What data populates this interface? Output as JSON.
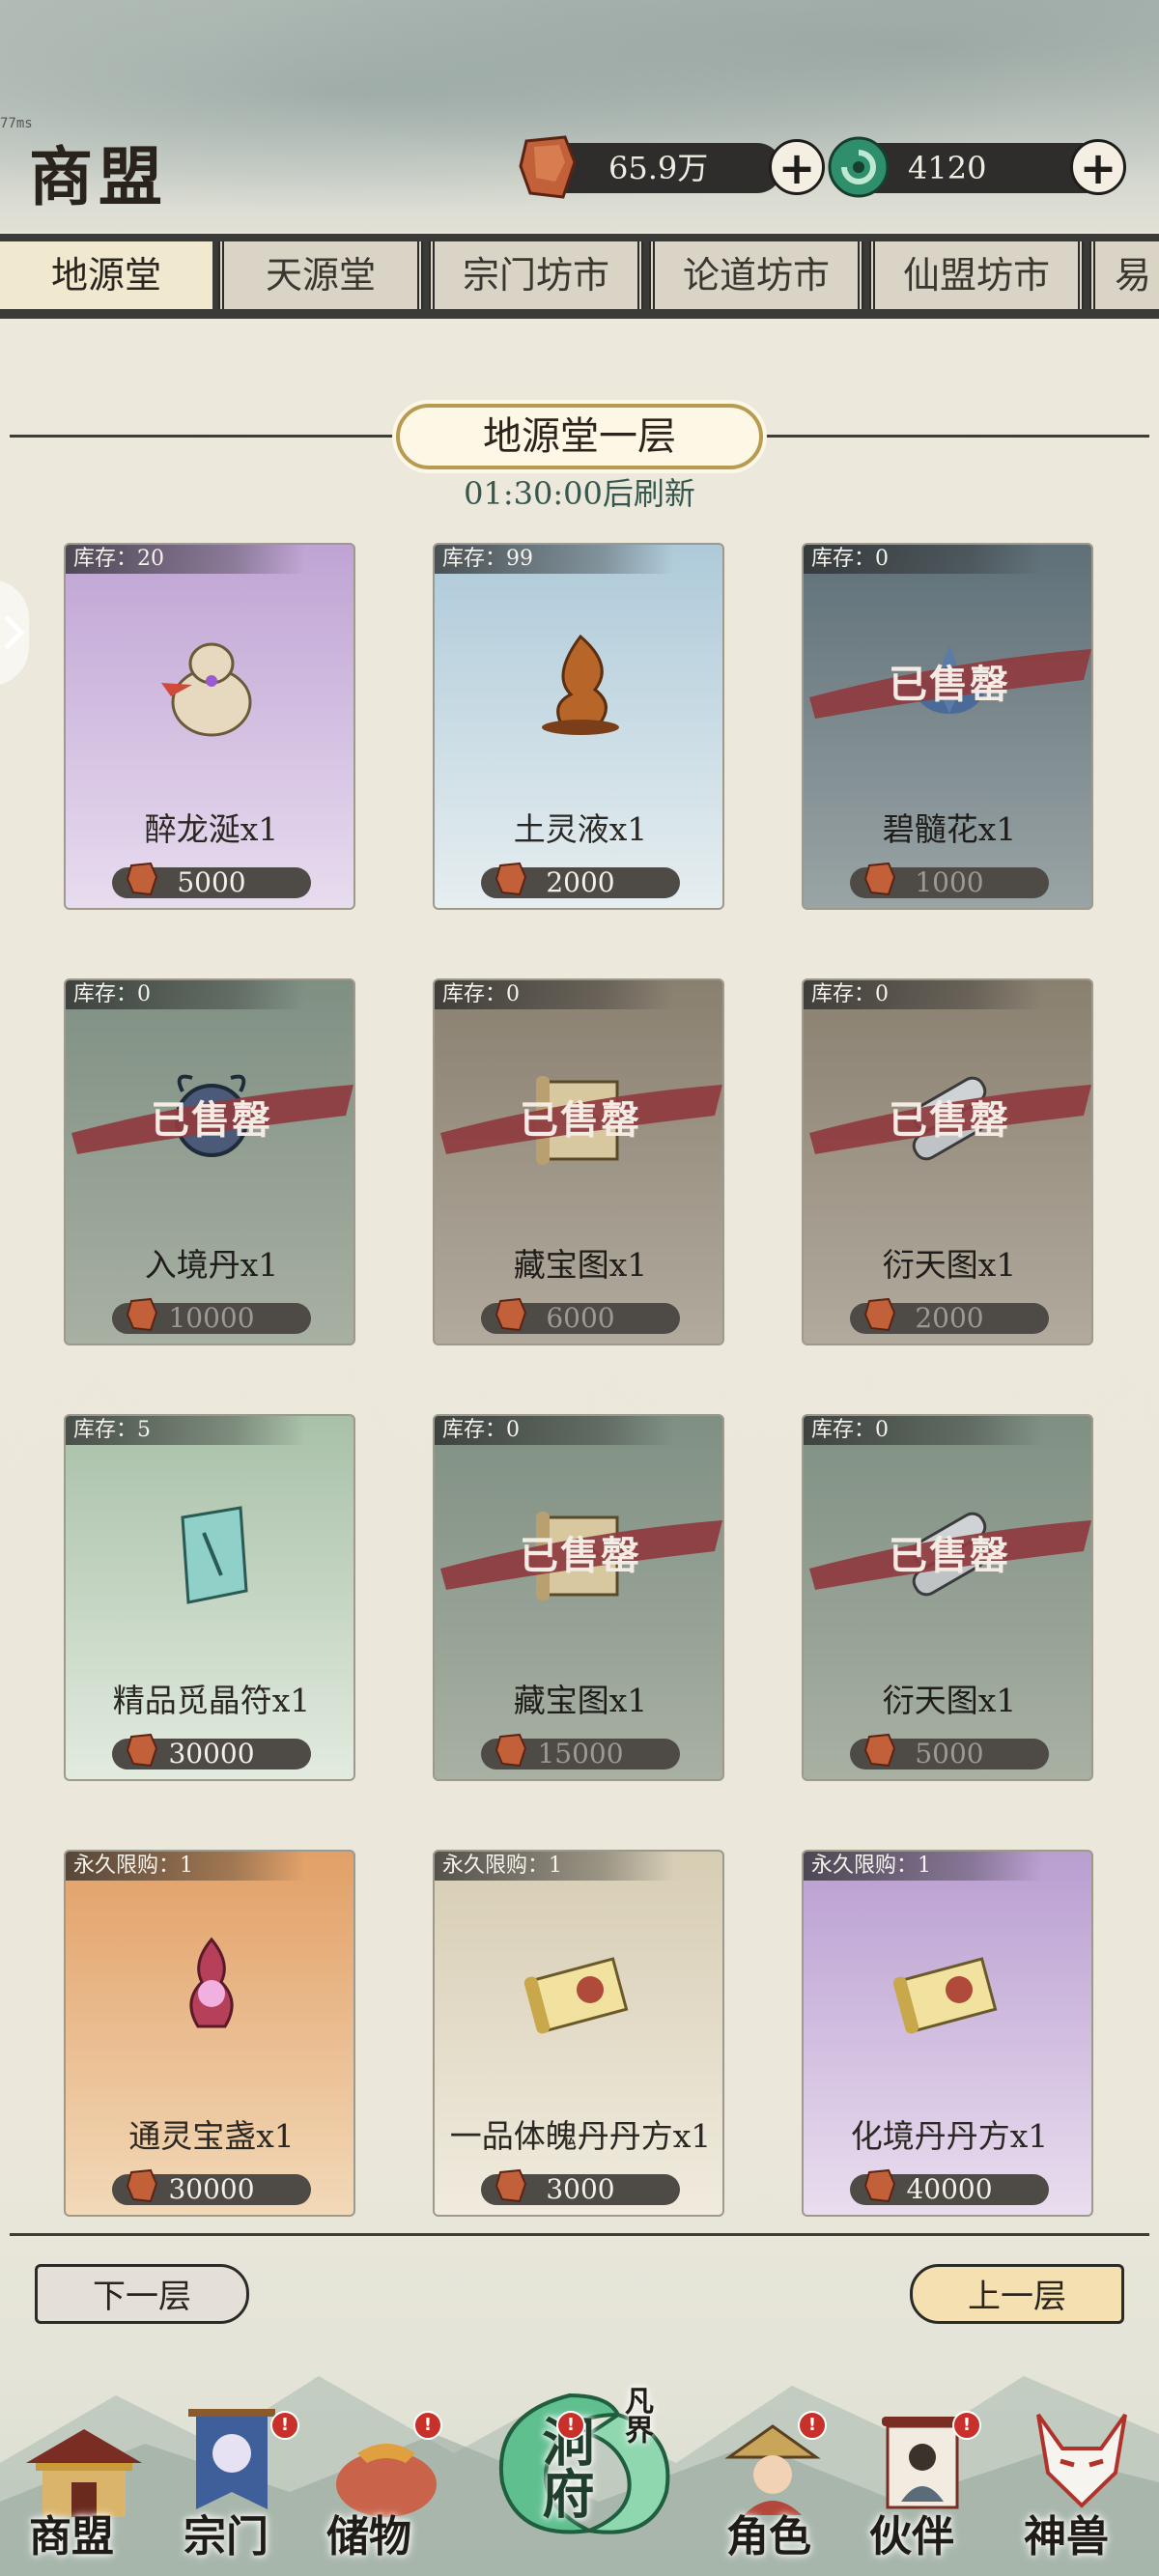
{
  "status": {
    "latency": "77ms"
  },
  "header": {
    "title": "商盟",
    "currency_spirit_stone": "65.9万",
    "currency_jade": "4120",
    "add_label": "+"
  },
  "tabs": [
    {
      "label": "地源堂",
      "active": true
    },
    {
      "label": "天源堂",
      "active": false
    },
    {
      "label": "宗门坊市",
      "active": false
    },
    {
      "label": "论道坊市",
      "active": false
    },
    {
      "label": "仙盟坊市",
      "active": false
    },
    {
      "label": "易",
      "active": false
    }
  ],
  "floor": {
    "title": "地源堂一层",
    "refresh": "01:30:00后刷新"
  },
  "sold_label": "已售罄",
  "items": [
    {
      "stock": "库存：20",
      "name": "醉龙涎x1",
      "price": "5000",
      "sold_out": false,
      "icon": "gourd-icon",
      "theme": "purple"
    },
    {
      "stock": "库存：99",
      "name": "土灵液x1",
      "price": "2000",
      "sold_out": false,
      "icon": "flame-icon",
      "theme": "blue"
    },
    {
      "stock": "库存：0",
      "name": "碧髓花x1",
      "price": "1000",
      "sold_out": true,
      "icon": "lotus-icon",
      "theme": "soldblue"
    },
    {
      "stock": "库存：0",
      "name": "入境丹x1",
      "price": "10000",
      "sold_out": true,
      "icon": "pill-icon",
      "theme": "green"
    },
    {
      "stock": "库存：0",
      "name": "藏宝图x1",
      "price": "6000",
      "sold_out": true,
      "icon": "map-scroll-icon",
      "theme": "brown"
    },
    {
      "stock": "库存：0",
      "name": "衍天图x1",
      "price": "2000",
      "sold_out": true,
      "icon": "rolled-scroll-icon",
      "theme": "brown"
    },
    {
      "stock": "库存：5",
      "name": "精品觅晶符x1",
      "price": "30000",
      "sold_out": false,
      "icon": "talisman-icon",
      "theme": "jade"
    },
    {
      "stock": "库存：0",
      "name": "藏宝图x1",
      "price": "15000",
      "sold_out": true,
      "icon": "map-scroll-icon",
      "theme": "green"
    },
    {
      "stock": "库存：0",
      "name": "衍天图x1",
      "price": "5000",
      "sold_out": true,
      "icon": "rolled-scroll-icon",
      "theme": "green"
    },
    {
      "stock": "永久限购：1",
      "name": "通灵宝盏x1",
      "price": "30000",
      "sold_out": false,
      "icon": "lantern-icon",
      "theme": "orange"
    },
    {
      "stock": "永久限购：1",
      "name": "一品体魄丹丹方x1",
      "price": "3000",
      "sold_out": false,
      "icon": "recipe-scroll-icon",
      "theme": "beige"
    },
    {
      "stock": "永久限购：1",
      "name": "化境丹丹方x1",
      "price": "40000",
      "sold_out": false,
      "icon": "recipe-scroll-icon",
      "theme": "violet"
    }
  ],
  "pager": {
    "next": "下一层",
    "prev": "上一层"
  },
  "bottom_nav": [
    {
      "label": "商盟",
      "icon": "pavilion-icon",
      "badge": false
    },
    {
      "label": "宗门",
      "icon": "banner-icon",
      "badge": true
    },
    {
      "label": "储物",
      "icon": "pouch-icon",
      "badge": true
    },
    {
      "label": "洞府",
      "icon": "jade-disc-icon",
      "badge": true
    },
    {
      "label": "凡界",
      "icon": "swap-icon",
      "badge": false
    },
    {
      "label": "角色",
      "icon": "character-icon",
      "badge": true
    },
    {
      "label": "伙伴",
      "icon": "scroll-portrait-icon",
      "badge": true
    },
    {
      "label": "神兽",
      "icon": "fox-mask-icon",
      "badge": false
    }
  ],
  "badge_text": "!"
}
